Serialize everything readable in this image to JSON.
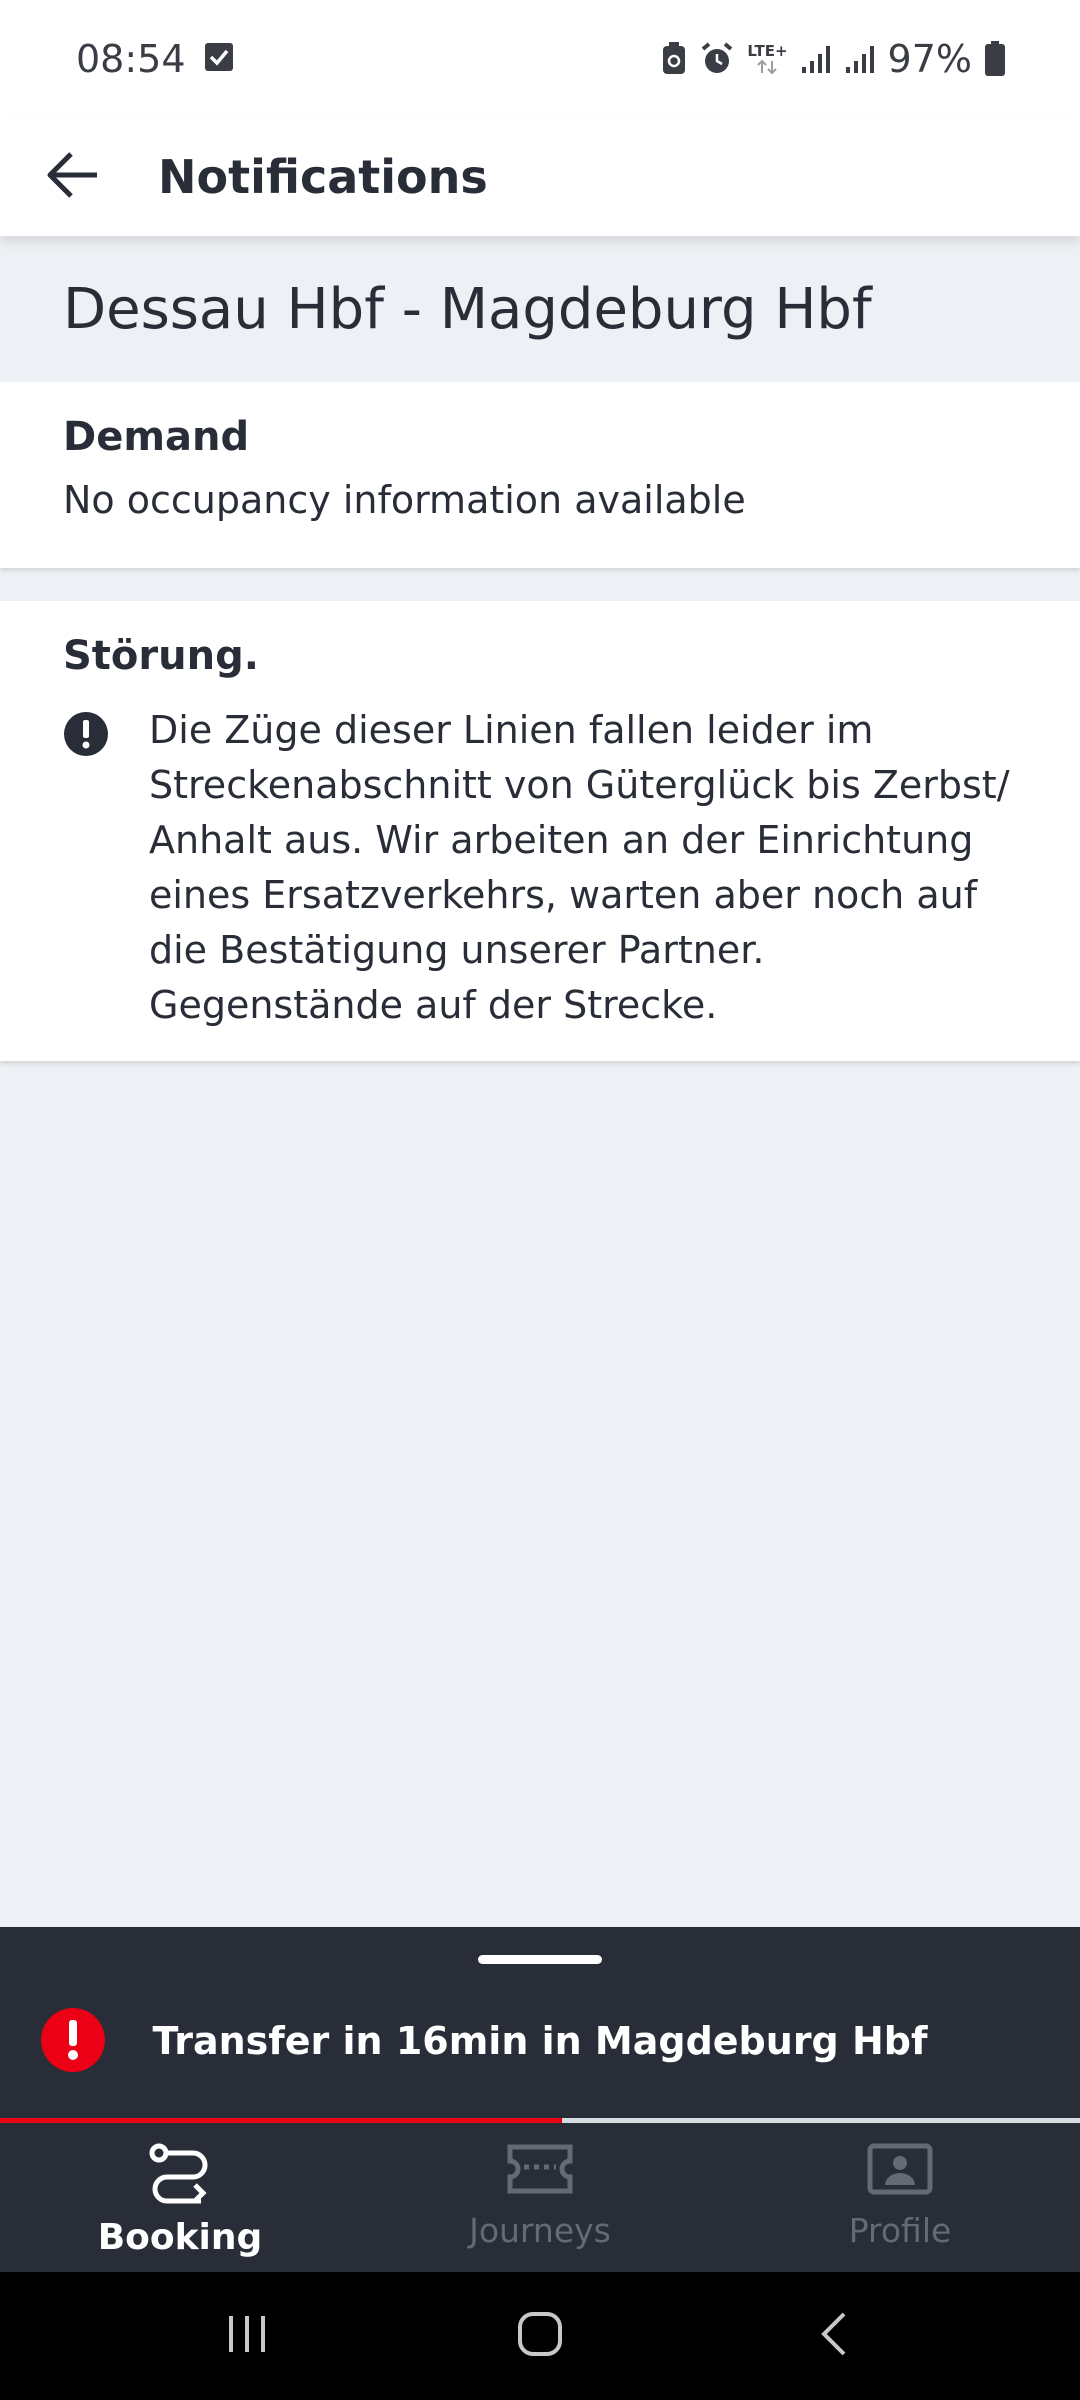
{
  "status_bar": {
    "time": "08:54",
    "network": "LTE+",
    "battery": "97%",
    "icons": [
      "check-box-icon",
      "battery-saver-icon",
      "alarm-icon",
      "lte-icon",
      "signal-icon",
      "signal-icon",
      "battery-icon"
    ]
  },
  "app_bar": {
    "title": "Notifications",
    "back_icon": "arrow-left-icon"
  },
  "route": {
    "title": "Dessau Hbf - Magdeburg Hbf"
  },
  "demand": {
    "heading": "Demand",
    "text": "No occupancy information available"
  },
  "disruption": {
    "heading": "Störung.",
    "icon": "exclamation-circle-icon",
    "text": "Die Züge dieser Linien fallen leider im Streckenabschnitt von Güterglück bis Zerbst/ Anhalt aus. Wir arbeiten an der Einrichtung eines Ersatzverkehrs, warten aber noch auf die Bestätigung unserer Partner. Gegenstände auf der Strecke."
  },
  "banner": {
    "text": "Transfer in 16min in Magdeburg Hbf",
    "icon": "alert-circle-icon",
    "progress": 0.52,
    "accent_color": "#ec0016"
  },
  "bottom_nav": {
    "items": [
      {
        "label": "Booking",
        "icon": "route-icon",
        "active": true
      },
      {
        "label": "Journeys",
        "icon": "ticket-icon",
        "active": false
      },
      {
        "label": "Profile",
        "icon": "profile-card-icon",
        "active": false
      }
    ]
  },
  "colors": {
    "background": "#edf0f4",
    "dark": "#282d37",
    "red": "#ec0016"
  }
}
